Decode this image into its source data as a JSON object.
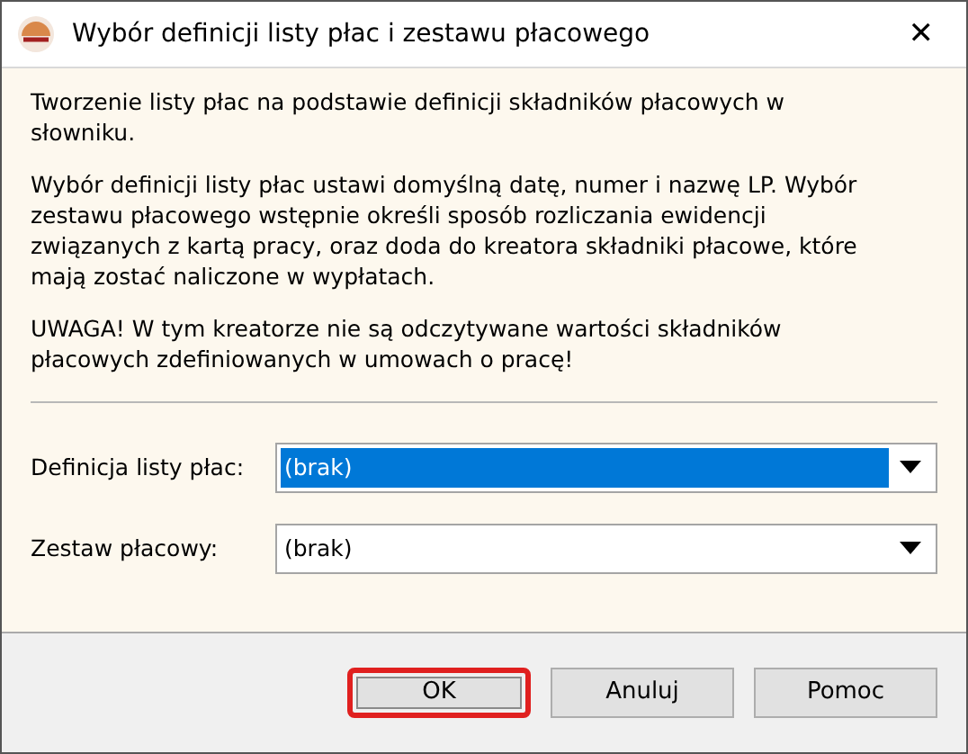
{
  "window": {
    "title": "Wybór definicji listy płac i zestawu płacowego",
    "close": "✕"
  },
  "paragraphs": [
    "Tworzenie listy płac na podstawie definicji składników płacowych w słowniku.",
    "Wybór definicji listy płac ustawi domyślną datę, numer i nazwę LP. Wybór zestawu płacowego wstępnie określi sposób rozliczania ewidencji związanych z kartą pracy, oraz doda do kreatora składniki płacowe, które mają zostać naliczone w wypłatach.",
    "UWAGA! W tym kreatorze nie są odczytywane wartości składników płacowych zdefiniowanych w umowach o pracę!"
  ],
  "fields": [
    {
      "label": "Definicja listy płac:",
      "value": "(brak)",
      "focused": true
    },
    {
      "label": "Zestaw płacowy:",
      "value": "(brak)",
      "focused": false
    }
  ],
  "buttons": [
    {
      "label": "OK",
      "highlighted": true
    },
    {
      "label": "Anuluj",
      "highlighted": false
    },
    {
      "label": "Pomoc",
      "highlighted": false
    }
  ]
}
